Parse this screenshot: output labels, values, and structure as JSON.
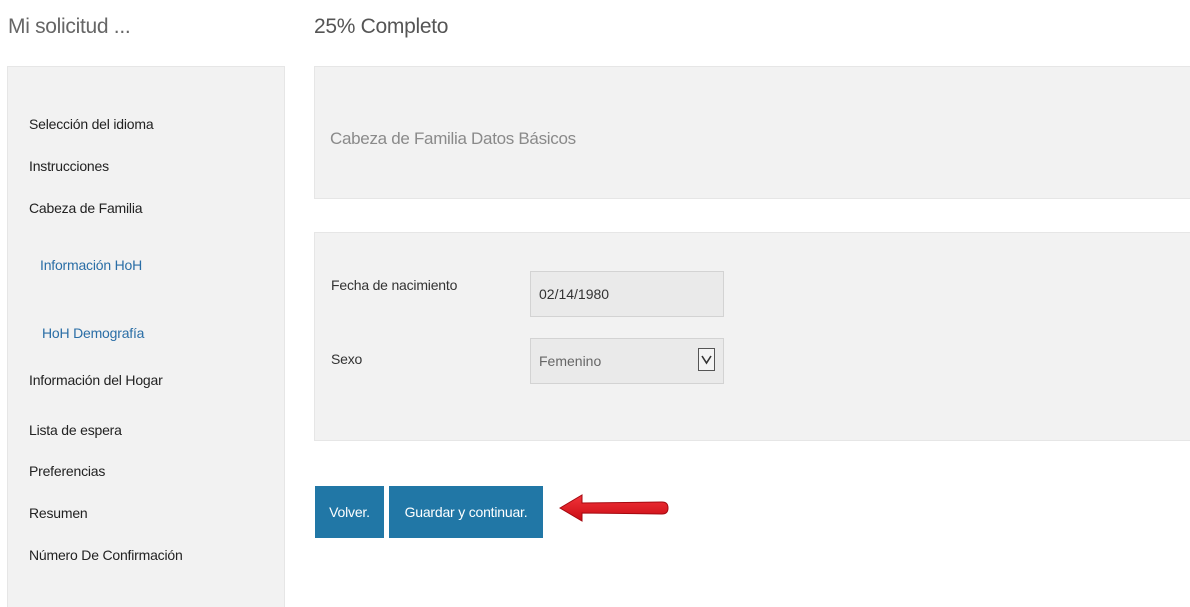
{
  "app": {
    "title": "Mi solicitud ...",
    "progress": "25% Completo",
    "progress_percent": 25
  },
  "sidebar": {
    "items": [
      {
        "label": "Selección del idioma"
      },
      {
        "label": "Instrucciones"
      },
      {
        "label": "Cabeza de Familia"
      },
      {
        "label": "Información HoH"
      },
      {
        "label": "HoH Demografía"
      },
      {
        "label": "Información del Hogar"
      },
      {
        "label": "Lista de espera"
      },
      {
        "label": "Preferencias"
      },
      {
        "label": "Resumen"
      },
      {
        "label": "Número De Confirmación"
      }
    ]
  },
  "section": {
    "title": "Cabeza de Familia Datos Básicos"
  },
  "form": {
    "dob_label": "Fecha de nacimiento",
    "dob_value": "02/14/1980",
    "sex_label": "Sexo",
    "sex_value": "Femenino"
  },
  "buttons": {
    "back": "Volver.",
    "save": "Guardar y continuar."
  },
  "colors": {
    "primary_button": "#2177a6",
    "arrow": "#e0101a",
    "sub_link": "#2a6ea6",
    "panel_bg": "#f2f2f2"
  },
  "icons": {
    "select_caret": "chevron-down-icon",
    "annotation": "arrow-left-icon"
  }
}
